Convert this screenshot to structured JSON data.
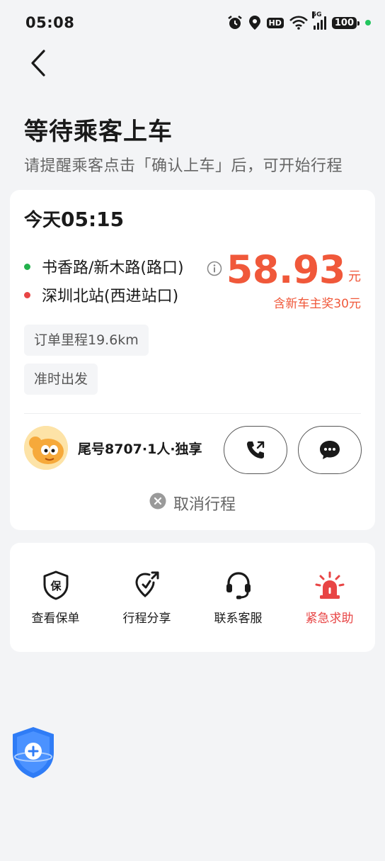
{
  "status_bar": {
    "time": "05:08",
    "hd": "HD",
    "network": "5G",
    "battery": "100"
  },
  "page": {
    "title": "等待乘客上车",
    "subtitle": "请提醒乘客点击「确认上车」后，可开始行程"
  },
  "trip": {
    "day": "今天",
    "time": "05:15",
    "pickup": "书香路/新木路(路口)",
    "dropoff": "深圳北站(西进站口)",
    "fare": "58.93",
    "fare_unit": "元",
    "bonus": "含新车主奖30元",
    "distance_tag": "订单里程19.6km",
    "ontime_tag": "准时出发",
    "passenger": "尾号8707·1人·独享",
    "cancel_label": "取消行程"
  },
  "actions": [
    {
      "label": "查看保单",
      "icon": "insurance-icon"
    },
    {
      "label": "行程分享",
      "icon": "share-trip-icon"
    },
    {
      "label": "联系客服",
      "icon": "headset-icon"
    },
    {
      "label": "紧急求助",
      "icon": "alarm-icon"
    }
  ],
  "colors": {
    "accent": "#f0583a",
    "danger": "#e84545",
    "green": "#22b14c"
  }
}
